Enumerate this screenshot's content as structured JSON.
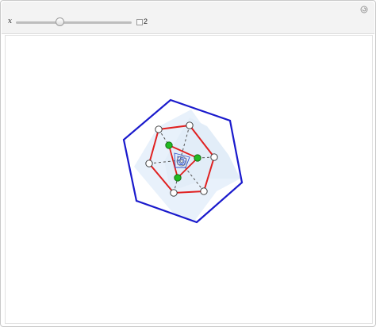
{
  "controls": {
    "variable_label": "x",
    "value_label": "2",
    "slider_fraction": 0.38
  },
  "colors": {
    "outer_hexagon": "#1a1acc",
    "inner_hexagon": "#e02020",
    "triangle": "#e02020",
    "green_points": "#22bb22",
    "star_fill": "#e8f1fb",
    "dashed_lines": "#555555",
    "spiral": "#3355cc"
  },
  "icons": {
    "reset": "reset-icon",
    "increment": "plus-toggle-icon"
  }
}
